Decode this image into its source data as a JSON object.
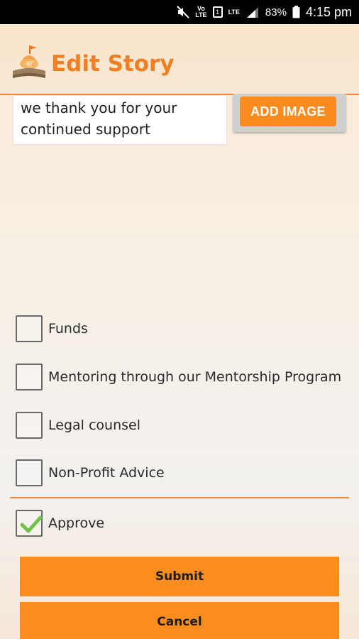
{
  "status_bar": {
    "battery_percent": "83%",
    "time": "4:15 pm",
    "network": "LTE",
    "volte": "VoLTE",
    "icons": [
      "mute-icon",
      "volte-icon",
      "sim-icon",
      "lte-signal-icon",
      "signal-icon",
      "battery-icon"
    ]
  },
  "header": {
    "title": "Edit Story",
    "logo_icon": "temple-logo-icon"
  },
  "story": {
    "text": "we thank you for your\ncontinued support",
    "add_image_label": "ADD IMAGE"
  },
  "help_options": [
    {
      "label": "Funds",
      "checked": false
    },
    {
      "label": "Mentoring through our Mentorship Program",
      "checked": false
    },
    {
      "label": "Legal counsel",
      "checked": false
    },
    {
      "label": "Non-Profit Advice",
      "checked": false
    }
  ],
  "approve": {
    "label": "Approve",
    "checked": true
  },
  "buttons": {
    "submit": "Submit",
    "cancel": "Cancel"
  },
  "colors": {
    "accent": "#fb8d1f",
    "title": "#ef7f22",
    "check": "#6fc24a"
  }
}
